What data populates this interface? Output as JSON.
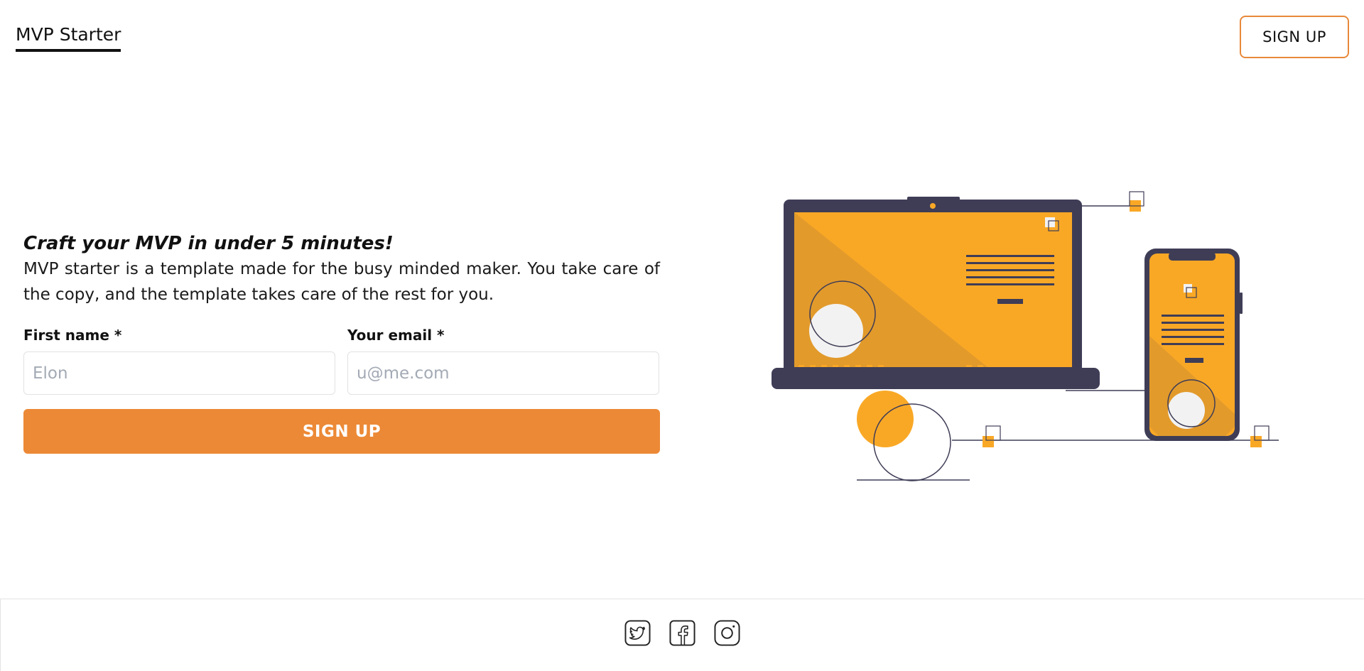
{
  "header": {
    "brand": "MVP Starter",
    "signup_label": "SIGN UP"
  },
  "hero": {
    "title": "Craft your MVP in under 5 minutes!",
    "description": "MVP starter is a template made for the busy minded maker. You take care of the copy, and the template takes care of the rest for you."
  },
  "form": {
    "first_name_label": "First name *",
    "first_name_placeholder": "Elon",
    "email_label": "Your email *",
    "email_placeholder": "u@me.com",
    "submit_label": "SIGN UP"
  },
  "footer": {
    "social": [
      "twitter-icon",
      "facebook-icon",
      "instagram-icon"
    ]
  },
  "colors": {
    "accent": "#ec8936",
    "illustration_orange": "#f9a826",
    "illustration_dark": "#3f3d56"
  }
}
